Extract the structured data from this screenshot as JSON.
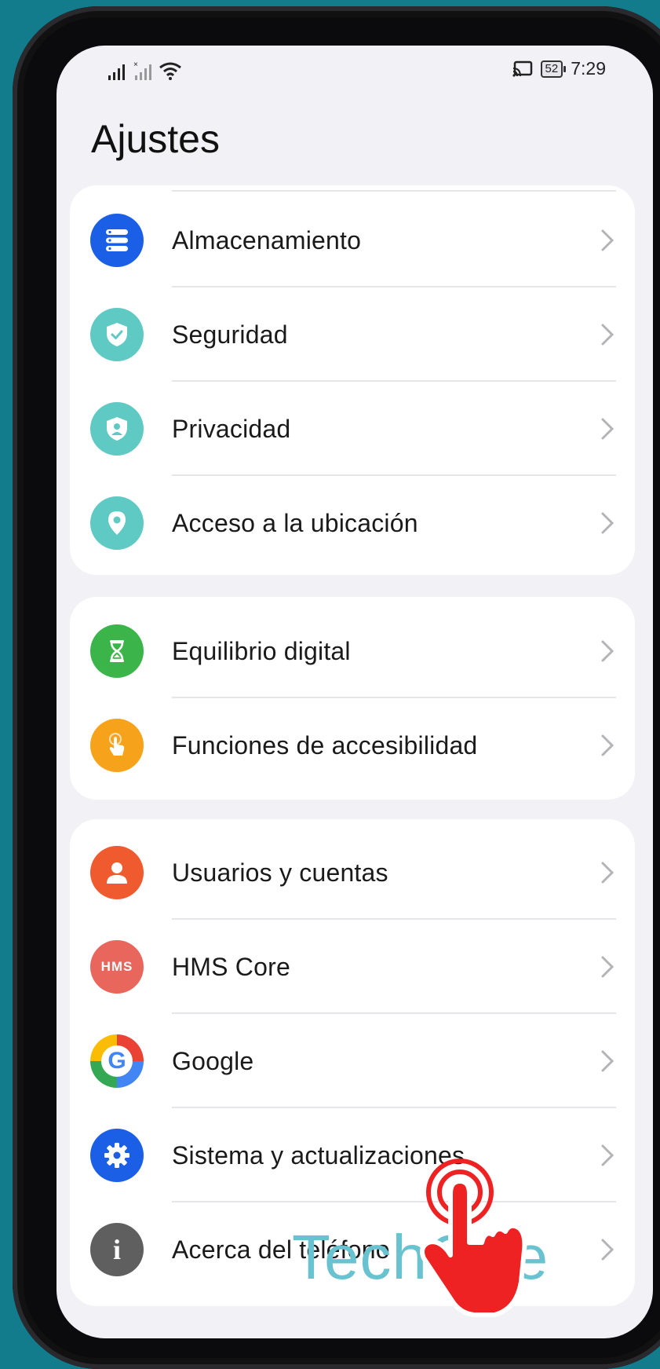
{
  "status_bar": {
    "signal_icon": "signal-icon",
    "sim2_icon": "no-sim-signal-icon",
    "wifi_icon": "wifi-icon",
    "cast_icon": "cast-icon",
    "battery_level": "52",
    "time": "7:29"
  },
  "header": {
    "title": "Ajustes"
  },
  "groups": [
    {
      "items": [
        {
          "label": "Almacenamiento",
          "icon": "storage-icon",
          "color": "#1a5fe6"
        },
        {
          "label": "Seguridad",
          "icon": "shield-check-icon",
          "color": "#5fc9c3"
        },
        {
          "label": "Privacidad",
          "icon": "privacy-shield-icon",
          "color": "#5fc9c3"
        },
        {
          "label": "Acceso a la ubicación",
          "icon": "location-pin-icon",
          "color": "#5fc9c3"
        }
      ]
    },
    {
      "items": [
        {
          "label": "Equilibrio digital",
          "icon": "hourglass-icon",
          "color": "#3bb54a"
        },
        {
          "label": "Funciones de accesibilidad",
          "icon": "hand-touch-icon",
          "color": "#f7a21b"
        }
      ]
    },
    {
      "items": [
        {
          "label": "Usuarios y cuentas",
          "icon": "user-icon",
          "color": "#ef5a2e"
        },
        {
          "label": "HMS Core",
          "icon": "hms-icon",
          "icon_text": "HMS",
          "color": "#e8665c"
        },
        {
          "label": "Google",
          "icon": "google-icon",
          "icon_text": "G",
          "color": "#4285f4"
        },
        {
          "label": "Sistema y actualizaciones",
          "icon": "gear-icon",
          "color": "#1a5fe6"
        },
        {
          "label": "Acerca del teléfono",
          "icon": "info-icon",
          "icon_text": "i",
          "color": "#5f5f5f"
        }
      ]
    }
  ],
  "overlay": {
    "watermark_text": "TechOne",
    "watermark_color": "#69c2cf",
    "pointer": "tap-hand-pointer-icon",
    "pointer_color": "#ee2222"
  }
}
